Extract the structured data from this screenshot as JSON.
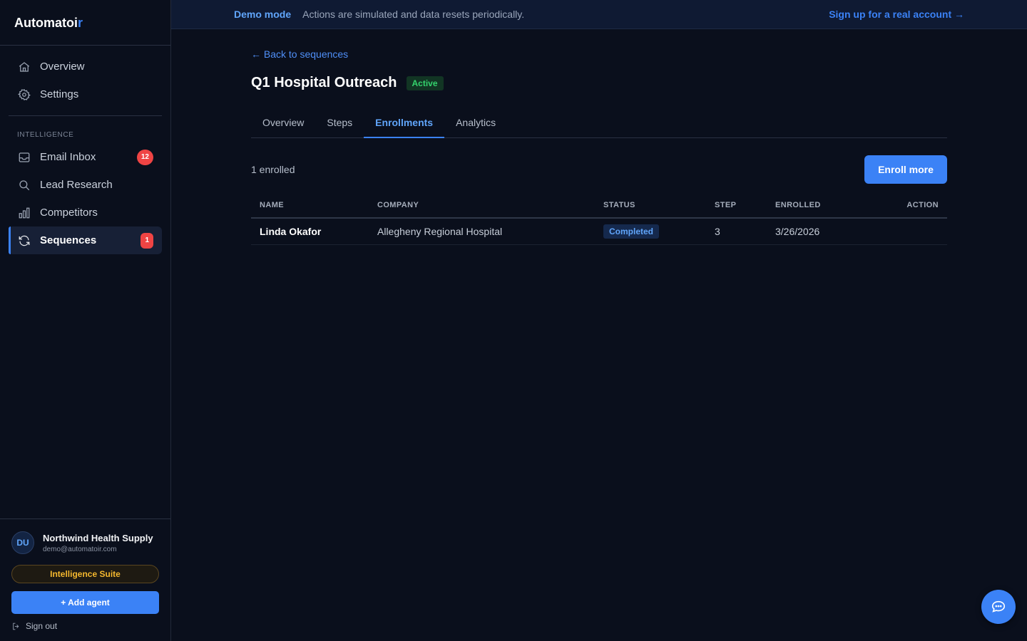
{
  "brand": {
    "name_main": "Automatoi",
    "name_accent": "r"
  },
  "nav": {
    "top_items": [
      {
        "label": "Overview",
        "icon": "home-icon"
      },
      {
        "label": "Settings",
        "icon": "gear-icon"
      }
    ],
    "section_label": "INTELLIGENCE",
    "intel_items": [
      {
        "label": "Email Inbox",
        "icon": "inbox-icon",
        "badge": "12"
      },
      {
        "label": "Lead Research",
        "icon": "search-icon"
      },
      {
        "label": "Competitors",
        "icon": "bar-chart-icon"
      },
      {
        "label": "Sequences",
        "icon": "refresh-icon",
        "badge": "1",
        "active": true
      }
    ]
  },
  "account": {
    "initials": "DU",
    "name": "Northwind Health Supply",
    "email": "demo@automatoir.com",
    "plan": "Intelligence Suite",
    "add_agent": "+ Add agent",
    "sign_out": "Sign out"
  },
  "banner": {
    "label": "Demo mode",
    "message": "Actions are simulated and data resets periodically.",
    "cta": "Sign up for a real account →"
  },
  "page": {
    "back": "← Back to sequences",
    "title": "Q1 Hospital Outreach",
    "status": "Active",
    "tabs": [
      "Overview",
      "Steps",
      "Enrollments",
      "Analytics"
    ],
    "active_tab": "Enrollments",
    "enrolled_count": "1 enrolled",
    "enroll_button": "Enroll more"
  },
  "table": {
    "headers": [
      "NAME",
      "COMPANY",
      "STATUS",
      "STEP",
      "ENROLLED",
      "ACTION"
    ],
    "rows": [
      {
        "name": "Linda Okafor",
        "company": "Allegheny Regional Hospital",
        "status": "Completed",
        "step": "3",
        "enrolled": "3/26/2026",
        "action": ""
      }
    ]
  },
  "colors": {
    "accent": "#3b82f6",
    "background": "#0a0f1c",
    "badge": "#ef4444",
    "active_status": "#34d36d",
    "plan_gold": "#f5b82e"
  }
}
